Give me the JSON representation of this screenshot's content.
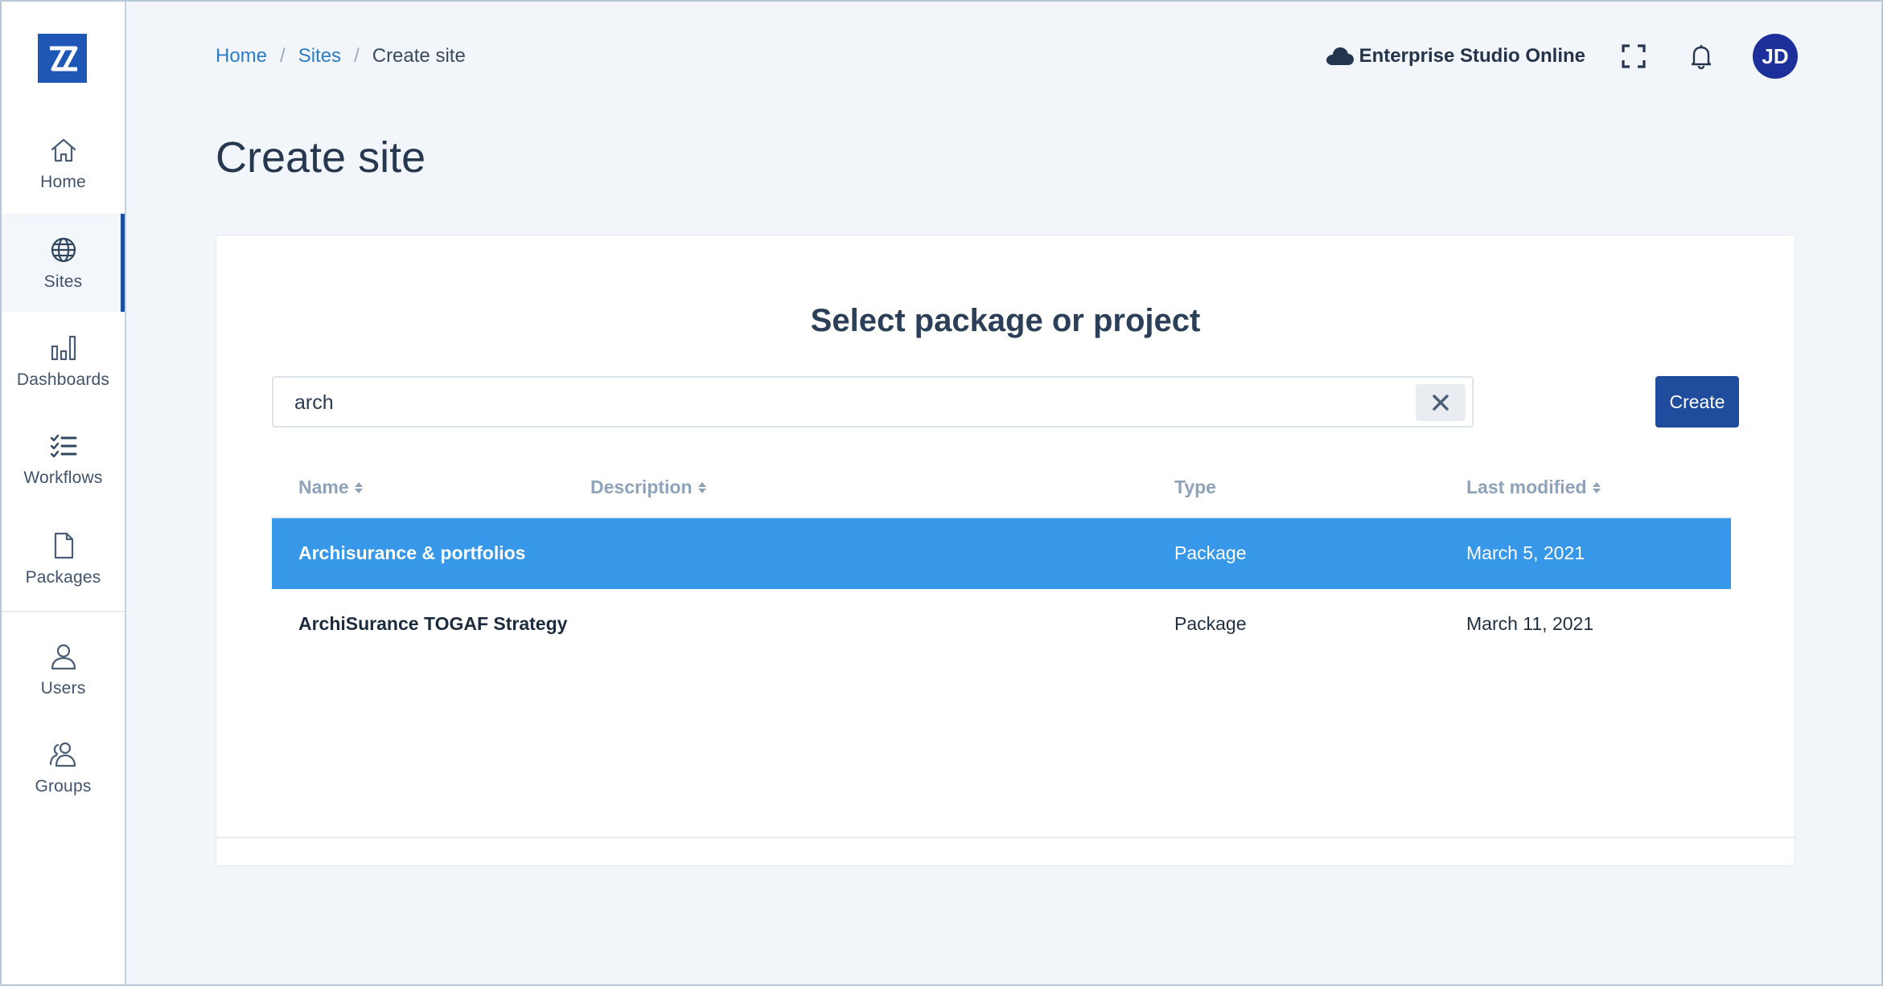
{
  "sidebar": {
    "logo": "ZZ",
    "items": [
      {
        "label": "Home",
        "icon": "home-icon"
      },
      {
        "label": "Sites",
        "icon": "globe-icon",
        "active": true
      },
      {
        "label": "Dashboards",
        "icon": "bar-chart-icon"
      },
      {
        "label": "Workflows",
        "icon": "checklist-icon"
      },
      {
        "label": "Packages",
        "icon": "file-icon"
      },
      {
        "label": "Users",
        "icon": "user-icon"
      },
      {
        "label": "Groups",
        "icon": "users-icon"
      }
    ]
  },
  "breadcrumb": {
    "items": [
      "Home",
      "Sites"
    ],
    "current": "Create site",
    "separator": "/"
  },
  "header": {
    "environment": "Enterprise Studio Online",
    "avatar_initials": "JD"
  },
  "page": {
    "title": "Create site"
  },
  "card": {
    "title": "Select package or project",
    "search": {
      "value": "arch"
    },
    "create_label": "Create"
  },
  "table": {
    "columns": [
      "Name",
      "Description",
      "Type",
      "Last modified"
    ],
    "rows": [
      {
        "name": "Archisurance & portfolios",
        "description": "",
        "type": "Package",
        "modified": "March 5, 2021",
        "selected": true
      },
      {
        "name": "ArchiSurance TOGAF Strategy",
        "description": "",
        "type": "Package",
        "modified": "March 11, 2021",
        "selected": false
      }
    ]
  },
  "colors": {
    "accent": "#1f4c9c",
    "selected_row": "#3797e8",
    "link": "#2c7cc6",
    "avatar": "#1c2f9a"
  }
}
